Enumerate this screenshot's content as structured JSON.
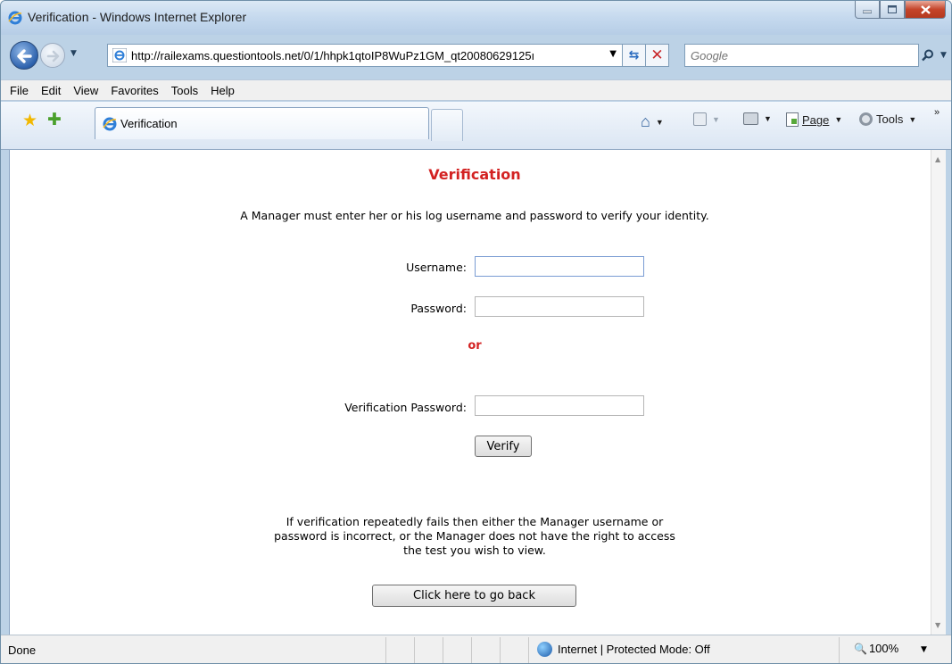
{
  "window": {
    "title": "Verification - Windows Internet Explorer"
  },
  "address_bar": {
    "url": "http://railexams.questiontools.net/0/1/hhpk1qtoIP8WuPz1GM_qt20080629125ı"
  },
  "search": {
    "placeholder": "Google"
  },
  "menu": [
    "File",
    "Edit",
    "View",
    "Favorites",
    "Tools",
    "Help"
  ],
  "tab": {
    "label": "Verification"
  },
  "command_bar": {
    "page_label": "Page",
    "tools_label": "Tools"
  },
  "page": {
    "title": "Verification",
    "intro": "A Manager must enter her or his log username and password to verify your identity.",
    "username_label": "Username:",
    "password_label": "Password:",
    "or_label": "or",
    "verification_password_label": "Verification Password:",
    "verify_button": "Verify",
    "help_text": "If verification repeatedly fails then either the Manager username or password is incorrect, or the Manager does not have the right to access the test you wish to view.",
    "help_lines": [
      "If verification repeatedly fails then either the Manager username or",
      "password is incorrect, or the Manager does not have the right to access",
      "the test you wish to view."
    ],
    "back_button": "Click here to go back",
    "username_value": "",
    "password_value": "",
    "verification_password_value": ""
  },
  "status_bar": {
    "status": "Done",
    "zone": "Internet | Protected Mode: Off",
    "zoom": "100%"
  },
  "colors": {
    "accent_red": "#d32222"
  },
  "icons": {
    "app": "internet-explorer-icon",
    "back": "back-arrow-icon",
    "forward": "forward-arrow-icon",
    "refresh": "refresh-icon",
    "stop": "stop-icon",
    "search": "search-icon",
    "favorites": "favorites-star-icon",
    "add_favorites": "add-favorites-icon",
    "home": "home-icon",
    "feeds": "feeds-icon",
    "print": "print-icon",
    "page": "page-icon",
    "tools": "gear-icon",
    "zone": "globe-icon",
    "zoom": "zoom-icon"
  }
}
